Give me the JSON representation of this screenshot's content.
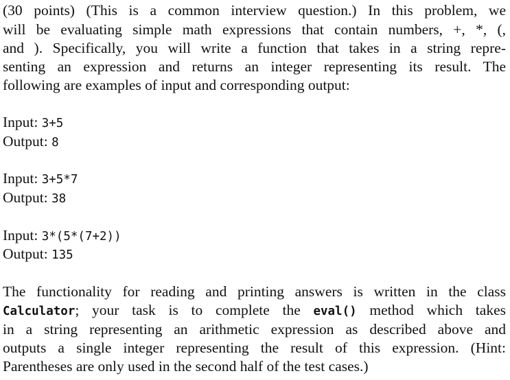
{
  "intro": {
    "lines": [
      "(30 points) (This is a common interview question.)  In this problem, we",
      "will be evaluating simple math expressions that contain numbers, +, *, (,",
      "and ).  Specifically, you will write a function that takes in a string repre-",
      "senting an expression and returns an integer representing its result.  The",
      "following are examples of input and corresponding output:"
    ]
  },
  "examples": [
    {
      "input_label": "Input:",
      "input": "3+5",
      "output_label": "Output:",
      "output": "8"
    },
    {
      "input_label": "Input:",
      "input": "3+5*7",
      "output_label": "Output:",
      "output": "38"
    },
    {
      "input_label": "Input:",
      "input": "3*(5*(7+2))",
      "output_label": "Output:",
      "output": "135"
    }
  ],
  "closing": {
    "line1": "The functionality for reading and printing answers is written in the class",
    "line2_code": "Calculator",
    "line2_mid": "; your task is to complete the ",
    "line2_code2": "eval()",
    "line2_end": " method which takes",
    "line3": "in a string representing an arithmetic expression as described above and",
    "line4": "outputs a single integer representing the result of this expression.  (Hint:",
    "line5": "Parentheses are only used in the second half of the test cases.)"
  }
}
